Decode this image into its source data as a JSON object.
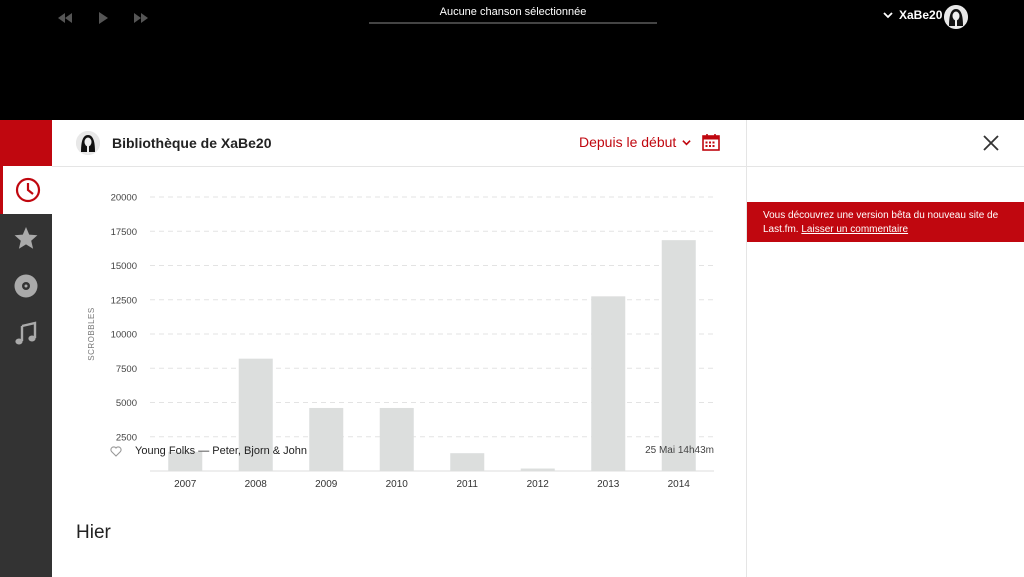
{
  "player": {
    "now_playing": "Aucune chanson sélectionnée",
    "user_name": "XaBe20"
  },
  "library": {
    "title": "Bibliothèque de XaBe20",
    "range_label": "Depuis le début"
  },
  "chart_data": {
    "type": "bar",
    "categories": [
      "2007",
      "2008",
      "2009",
      "2010",
      "2011",
      "2012",
      "2013",
      "2014"
    ],
    "values": [
      1400,
      8200,
      4600,
      4600,
      1300,
      180,
      12750,
      16850
    ],
    "ylabel": "SCROBBLES",
    "yticks": [
      2500,
      5000,
      7500,
      10000,
      12500,
      15000,
      17500,
      20000
    ],
    "ylim": [
      0,
      20000
    ],
    "bar_color": "#dcdedd",
    "grid": true
  },
  "recent": {
    "section_title": "Hier",
    "tracks": [
      {
        "name": "Young Folks — Peter, Bjorn & John",
        "time": "25 Mai 14h43m"
      }
    ]
  },
  "banner": {
    "text": "Vous découvrez une version bêta du nouveau site de Last.fm.",
    "link": "Laisser un commentaire"
  },
  "colors": {
    "accent": "#c0070f",
    "sidebar": "#333333",
    "topbar": "#000000"
  }
}
